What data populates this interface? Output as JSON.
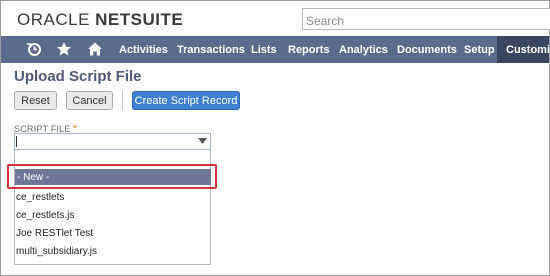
{
  "header": {
    "logo_part1": "ORACLE",
    "logo_part2": "NETSUITE",
    "search_placeholder": "Search"
  },
  "nav": {
    "icons": [
      "recent-icon",
      "star-icon",
      "home-icon"
    ],
    "items": [
      "Activities",
      "Transactions",
      "Lists",
      "Reports",
      "Analytics",
      "Documents",
      "Setup"
    ],
    "active_item": "Customiza"
  },
  "page": {
    "title": "Upload Script File"
  },
  "toolbar": {
    "reset_label": "Reset",
    "cancel_label": "Cancel",
    "create_label": "Create Script Record"
  },
  "form": {
    "script_file_label": "SCRIPT FILE",
    "required_mark": "*",
    "script_file_value": ""
  },
  "dropdown": {
    "options": [
      "- New -",
      "ce_restlets",
      "ce_restlets.js",
      "Joe RESTlet Test",
      "multi_subsidiary.js"
    ],
    "selected_index": 0
  },
  "colors": {
    "nav_bg": "#5c6a8c",
    "nav_active_bg": "#3a4660",
    "title_color": "#4d5b7a",
    "primary_button": "#3f7fd3",
    "selected_option_bg": "#6e7896",
    "highlight_border": "#d6353c",
    "required_mark": "#d8872b"
  }
}
